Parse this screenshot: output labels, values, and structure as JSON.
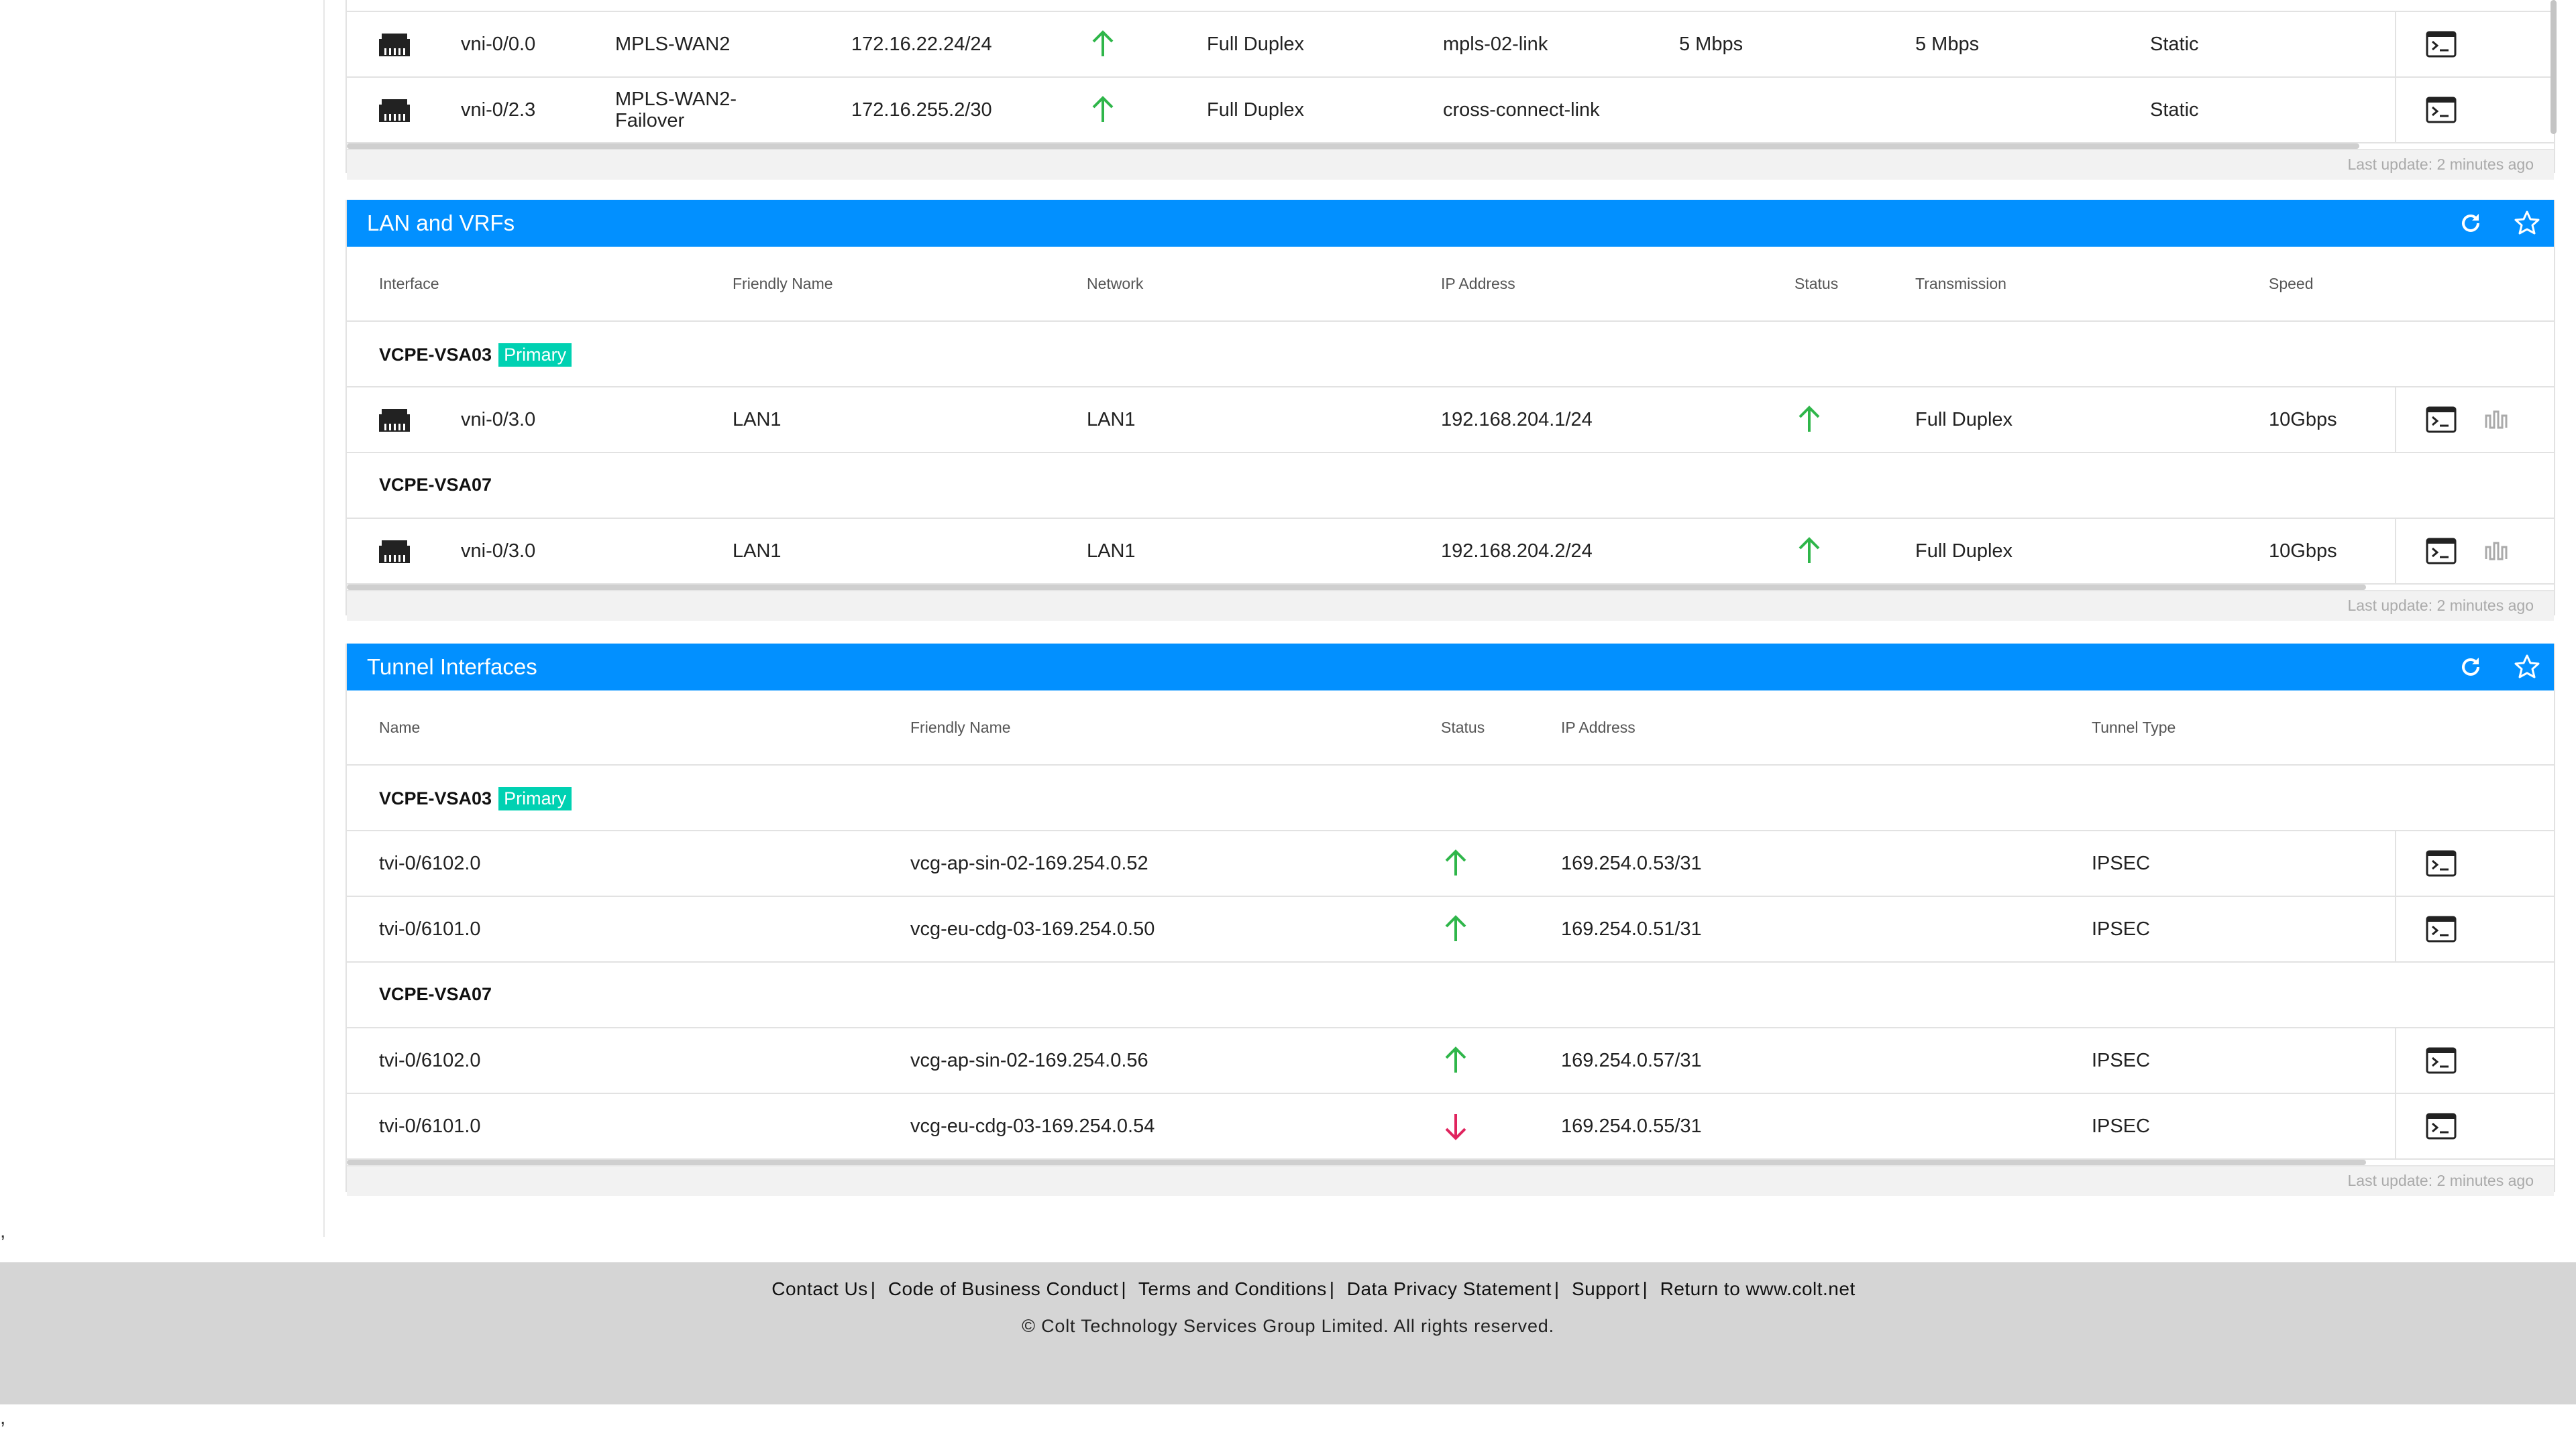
{
  "wan": {
    "rows": [
      {
        "interface": "vni-0/0.0",
        "friendly": "MPLS-WAN2",
        "ip": "172.16.22.24/24",
        "status": "up",
        "transmission": "Full Duplex",
        "link": "mpls-02-link",
        "up_speed": "5 Mbps",
        "down_speed": "5 Mbps",
        "type": "Static"
      },
      {
        "interface": "vni-0/2.3",
        "friendly": "MPLS-WAN2-Failover",
        "ip": "172.16.255.2/30",
        "status": "up",
        "transmission": "Full Duplex",
        "link": "cross-connect-link",
        "up_speed": "",
        "down_speed": "",
        "type": "Static"
      }
    ],
    "last_update": "Last update: 2 minutes ago"
  },
  "lan": {
    "title": "LAN and VRFs",
    "columns": [
      "Interface",
      "Friendly Name",
      "Network",
      "IP Address",
      "Status",
      "Transmission",
      "Speed"
    ],
    "groups": [
      {
        "name": "VCPE-VSA03",
        "badge": "Primary",
        "rows": [
          {
            "interface": "vni-0/3.0",
            "friendly": "LAN1",
            "network": "LAN1",
            "ip": "192.168.204.1/24",
            "status": "up",
            "transmission": "Full Duplex",
            "speed": "10Gbps"
          }
        ]
      },
      {
        "name": "VCPE-VSA07",
        "badge": "",
        "rows": [
          {
            "interface": "vni-0/3.0",
            "friendly": "LAN1",
            "network": "LAN1",
            "ip": "192.168.204.2/24",
            "status": "up",
            "transmission": "Full Duplex",
            "speed": "10Gbps"
          }
        ]
      }
    ],
    "last_update": "Last update: 2 minutes ago"
  },
  "tunnel": {
    "title": "Tunnel Interfaces",
    "columns": [
      "Name",
      "Friendly Name",
      "Status",
      "IP Address",
      "Tunnel Type"
    ],
    "groups": [
      {
        "name": "VCPE-VSA03",
        "badge": "Primary",
        "rows": [
          {
            "name": "tvi-0/6102.0",
            "friendly": "vcg-ap-sin-02-169.254.0.52",
            "status": "up",
            "ip": "169.254.0.53/31",
            "type": "IPSEC"
          },
          {
            "name": "tvi-0/6101.0",
            "friendly": "vcg-eu-cdg-03-169.254.0.50",
            "status": "up",
            "ip": "169.254.0.51/31",
            "type": "IPSEC"
          }
        ]
      },
      {
        "name": "VCPE-VSA07",
        "badge": "",
        "rows": [
          {
            "name": "tvi-0/6102.0",
            "friendly": "vcg-ap-sin-02-169.254.0.56",
            "status": "up",
            "ip": "169.254.0.57/31",
            "type": "IPSEC"
          },
          {
            "name": "tvi-0/6101.0",
            "friendly": "vcg-eu-cdg-03-169.254.0.54",
            "status": "down",
            "ip": "169.254.0.55/31",
            "type": "IPSEC"
          }
        ]
      }
    ],
    "last_update": "Last update: 2 minutes ago"
  },
  "footer": {
    "links": [
      "Contact Us",
      "Code of Business Conduct",
      "Terms and Conditions",
      "Data Privacy Statement",
      "Support",
      "Return to www.colt.net"
    ],
    "separator": "|",
    "copyright": "© Colt Technology Services Group Limited. All rights reserved."
  },
  "stray": {
    "comma_1": ",",
    "comma_2": ","
  },
  "colors": {
    "header_blue": "#0290ff",
    "badge_teal": "#00d1b2",
    "status_up": "#2fb64a",
    "status_down": "#e0245e"
  },
  "icons": {
    "ethernet": "ethernet-port-icon",
    "terminal": "terminal-icon",
    "refresh": "refresh-icon",
    "favorite": "star-icon",
    "diagnostic": "waveform-icon",
    "up": "arrow-up-icon",
    "down": "arrow-down-icon"
  }
}
